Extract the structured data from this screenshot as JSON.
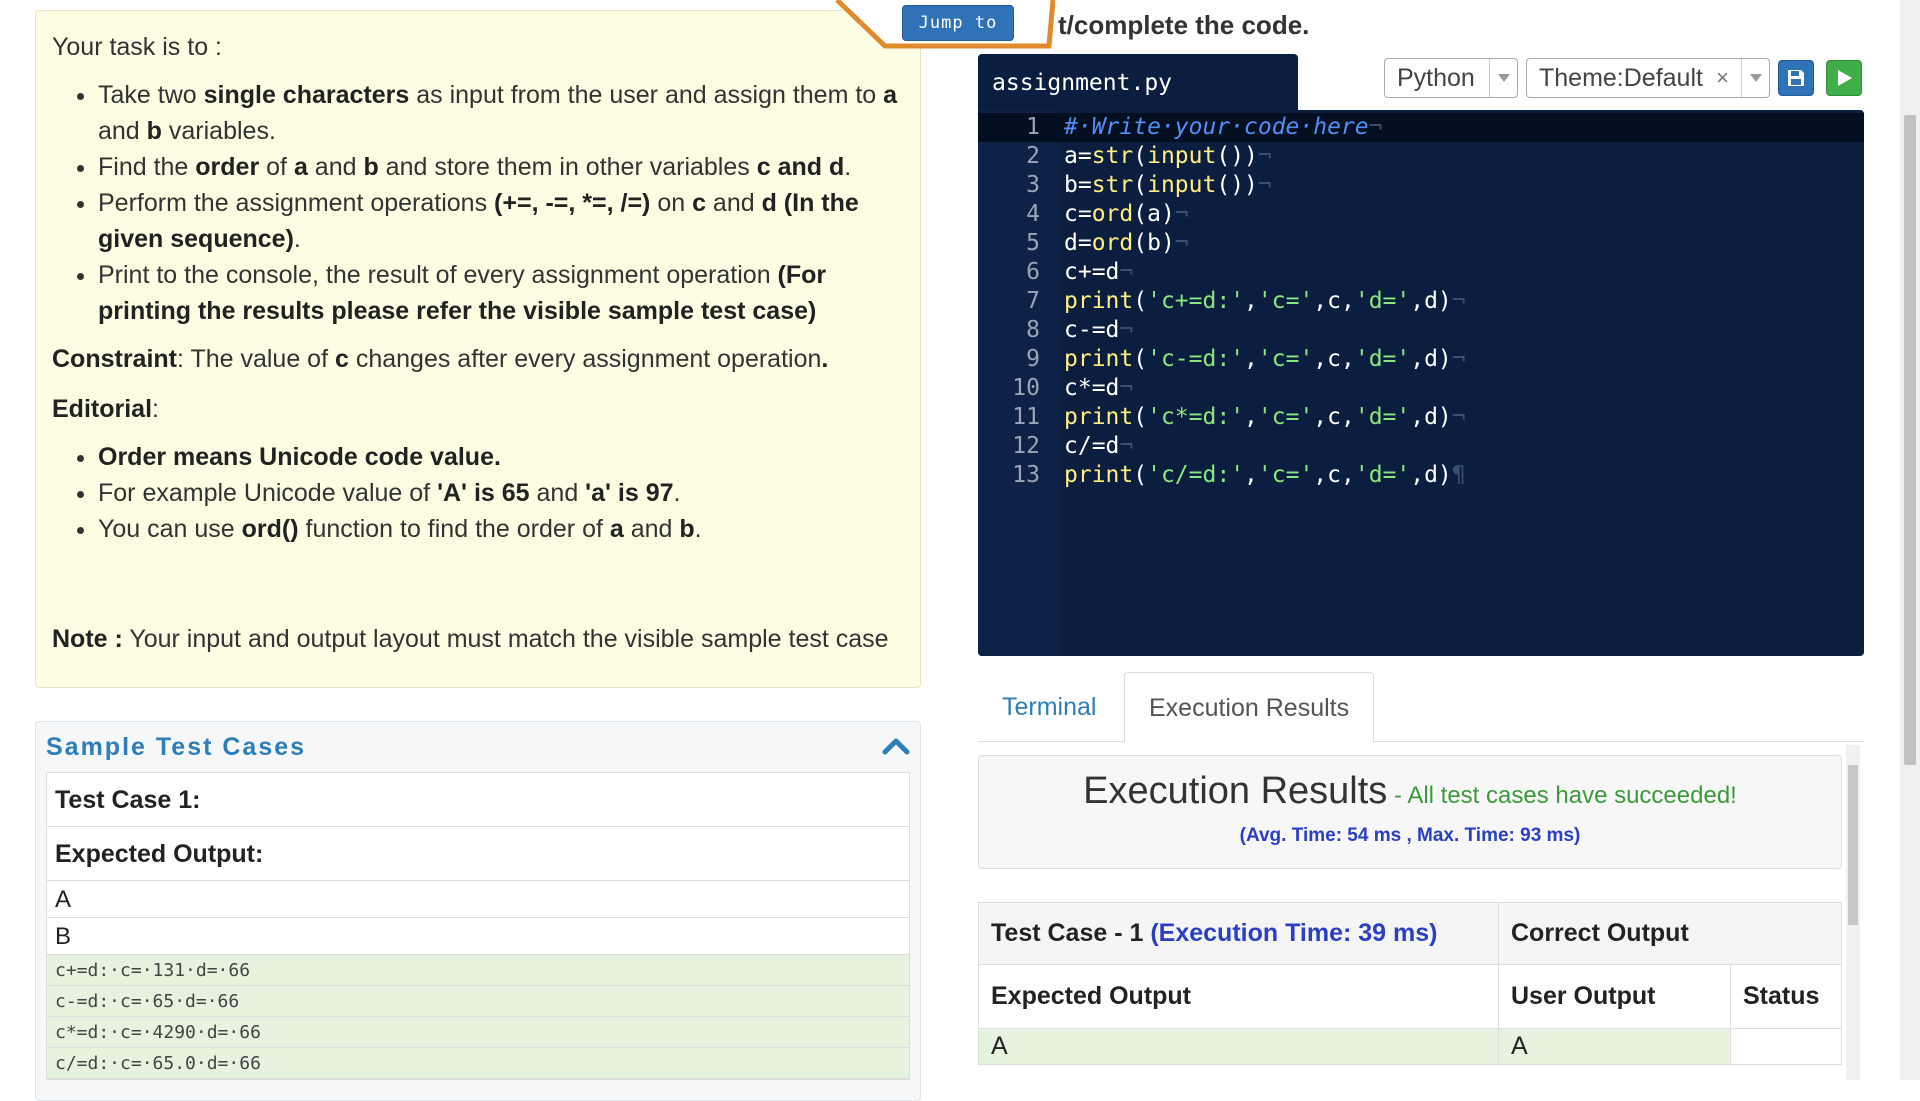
{
  "problem": {
    "intro": "Your task is to :",
    "bullets": [
      {
        "parts": [
          "Take two ",
          "single characters",
          " as input from the user and assign them to ",
          "a",
          " and ",
          "b",
          " variables."
        ]
      },
      {
        "parts": [
          "Find the ",
          "order",
          " of ",
          "a",
          " and ",
          "b",
          " and store them in other variables ",
          "c and d",
          "."
        ]
      },
      {
        "parts": [
          "Perform the assignment operations ",
          "(+=, -=, *=, /=)",
          " on ",
          "c",
          " and ",
          "d (In the given sequence)",
          "."
        ]
      },
      {
        "parts": [
          "Print to the console, the result of every assignment operation ",
          "(For printing the results please refer the visible sample test case)",
          ""
        ]
      }
    ],
    "constraint_label": "Constraint",
    "constraint_pre": ": The value of ",
    "constraint_var": "c",
    "constraint_post": " changes after every assignment operation",
    "constraint_end": ".",
    "editorial_label": "Editorial",
    "editorial_colon": ":",
    "editorial_bullets": [
      {
        "parts": [
          "Order means Unicode code value.",
          "",
          "",
          "",
          "",
          "",
          ""
        ]
      },
      {
        "parts": [
          "For example Unicode value of ",
          "'A' is 65",
          " and ",
          "'a' is 97",
          ".",
          "",
          ""
        ]
      },
      {
        "parts": [
          "You can use ",
          "ord()",
          " function to find the order of ",
          "a",
          " and ",
          "b",
          "."
        ]
      }
    ],
    "note_label": "Note :",
    "note_text": " Your input and output layout must match the visible sample test case"
  },
  "samples": {
    "title": "Sample Test Cases",
    "test_case_label": "Test Case 1:",
    "expected_output_label": "Expected Output:",
    "inputs": [
      "A",
      "B"
    ],
    "outputs": [
      "c+=d:·c=·131·d=·66",
      "c-=d:·c=·65·d=·66",
      "c*=d:·c=·4290·d=·66",
      "c/=d:·c=·65.0·d=·66"
    ]
  },
  "header": {
    "jump_label": "Jump to",
    "heading_fragment": "t/complete the code."
  },
  "editor": {
    "file_name": "assignment.py",
    "language": "Python",
    "theme": "Theme:Default",
    "theme_clear": "×",
    "line_numbers": [
      "1",
      "2",
      "3",
      "4",
      "5",
      "6",
      "7",
      "8",
      "9",
      "10",
      "11",
      "12",
      "13"
    ],
    "lines": [
      [
        {
          "t": "cm",
          "v": "#·Write·your·code·here"
        },
        {
          "t": "eol",
          "v": "¬"
        }
      ],
      [
        {
          "t": "op",
          "v": "a="
        },
        {
          "t": "fn",
          "v": "str"
        },
        {
          "t": "op",
          "v": "("
        },
        {
          "t": "fn",
          "v": "input"
        },
        {
          "t": "op",
          "v": "())"
        },
        {
          "t": "eol",
          "v": "¬"
        }
      ],
      [
        {
          "t": "op",
          "v": "b="
        },
        {
          "t": "fn",
          "v": "str"
        },
        {
          "t": "op",
          "v": "("
        },
        {
          "t": "fn",
          "v": "input"
        },
        {
          "t": "op",
          "v": "())"
        },
        {
          "t": "eol",
          "v": "¬"
        }
      ],
      [
        {
          "t": "op",
          "v": "c="
        },
        {
          "t": "fn",
          "v": "ord"
        },
        {
          "t": "op",
          "v": "(a)"
        },
        {
          "t": "eol",
          "v": "¬"
        }
      ],
      [
        {
          "t": "op",
          "v": "d="
        },
        {
          "t": "fn",
          "v": "ord"
        },
        {
          "t": "op",
          "v": "(b)"
        },
        {
          "t": "eol",
          "v": "¬"
        }
      ],
      [
        {
          "t": "op",
          "v": "c+=d"
        },
        {
          "t": "eol",
          "v": "¬"
        }
      ],
      [
        {
          "t": "fn",
          "v": "print"
        },
        {
          "t": "op",
          "v": "("
        },
        {
          "t": "st",
          "v": "'c+=d:'"
        },
        {
          "t": "op",
          "v": ","
        },
        {
          "t": "st",
          "v": "'c='"
        },
        {
          "t": "op",
          "v": ",c,"
        },
        {
          "t": "st",
          "v": "'d='"
        },
        {
          "t": "op",
          "v": ",d)"
        },
        {
          "t": "eol",
          "v": "¬"
        }
      ],
      [
        {
          "t": "op",
          "v": "c-=d"
        },
        {
          "t": "eol",
          "v": "¬"
        }
      ],
      [
        {
          "t": "fn",
          "v": "print"
        },
        {
          "t": "op",
          "v": "("
        },
        {
          "t": "st",
          "v": "'c-=d:'"
        },
        {
          "t": "op",
          "v": ","
        },
        {
          "t": "st",
          "v": "'c='"
        },
        {
          "t": "op",
          "v": ",c,"
        },
        {
          "t": "st",
          "v": "'d='"
        },
        {
          "t": "op",
          "v": ",d)"
        },
        {
          "t": "eol",
          "v": "¬"
        }
      ],
      [
        {
          "t": "op",
          "v": "c*=d"
        },
        {
          "t": "eol",
          "v": "¬"
        }
      ],
      [
        {
          "t": "fn",
          "v": "print"
        },
        {
          "t": "op",
          "v": "("
        },
        {
          "t": "st",
          "v": "'c*=d:'"
        },
        {
          "t": "op",
          "v": ","
        },
        {
          "t": "st",
          "v": "'c='"
        },
        {
          "t": "op",
          "v": ",c,"
        },
        {
          "t": "st",
          "v": "'d='"
        },
        {
          "t": "op",
          "v": ",d)"
        },
        {
          "t": "eol",
          "v": "¬"
        }
      ],
      [
        {
          "t": "op",
          "v": "c/=d"
        },
        {
          "t": "eol",
          "v": "¬"
        }
      ],
      [
        {
          "t": "fn",
          "v": "print"
        },
        {
          "t": "op",
          "v": "("
        },
        {
          "t": "st",
          "v": "'c/=d:'"
        },
        {
          "t": "op",
          "v": ","
        },
        {
          "t": "st",
          "v": "'c='"
        },
        {
          "t": "op",
          "v": ",c,"
        },
        {
          "t": "st",
          "v": "'d='"
        },
        {
          "t": "op",
          "v": ",d)"
        },
        {
          "t": "eol",
          "v": "¶"
        }
      ]
    ]
  },
  "results": {
    "tabs": [
      "Terminal",
      "Execution Results"
    ],
    "title": "Execution Results",
    "status": " - All test cases have succeeded!",
    "timing": "(Avg. Time: 54 ms , Max. Time: 93 ms)",
    "test_case_label": "Test Case - 1",
    "test_case_time": "(Execution Time: 39 ms)",
    "correct_output_label": "Correct Output",
    "expected_output_label": "Expected Output",
    "user_output_label": "User Output",
    "status_label": "Status",
    "row_expected": "A",
    "row_user": "A"
  },
  "colors": {
    "accent_blue": "#2e7fb8",
    "editor_bg": "#0b1e3f",
    "success_green": "#3c9a3c",
    "panel_yellow": "#fdfde4"
  },
  "icons": [
    "collapse-chevron-up-icon",
    "dropdown-arrow-icon",
    "save-icon",
    "run-play-icon"
  ]
}
